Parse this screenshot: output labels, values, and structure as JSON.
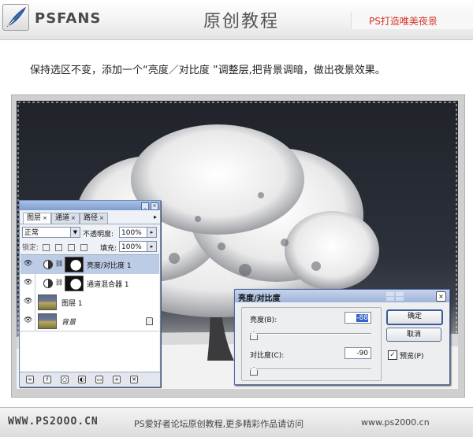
{
  "banner": {
    "logo": "PSFANS",
    "title": "原创教程",
    "right_text": "PS打造唯美夜景"
  },
  "instruction": "保持选区不变，添加一个“亮度／对比度 ”调整层,把背景调暗，做出夜景效果。",
  "layers_panel": {
    "tabs": [
      {
        "label": "图层",
        "active": true
      },
      {
        "label": "通道",
        "active": false
      },
      {
        "label": "路径",
        "active": false
      }
    ],
    "blend_mode": "正常",
    "opacity_label": "不透明度:",
    "opacity_value": "100%",
    "lock_label": "锁定:",
    "fill_label": "填充:",
    "fill_value": "100%",
    "layers": [
      {
        "name": "亮度/对比度 1",
        "selected": true,
        "type": "adjustment"
      },
      {
        "name": "通道混合器 1",
        "selected": false,
        "type": "adjustment"
      },
      {
        "name": "图层 1",
        "selected": false,
        "type": "image"
      },
      {
        "name": "背景",
        "selected": false,
        "type": "background"
      }
    ]
  },
  "dialog": {
    "title": "亮度/对比度",
    "brightness_label": "亮度(B):",
    "brightness_value": "-88",
    "contrast_label": "对比度(C):",
    "contrast_value": "-90",
    "ok_label": "确定",
    "cancel_label": "取消",
    "preview_label": "预览(P)",
    "preview_checked": true
  },
  "footer": {
    "left": "WWW.PS2OOO.CN",
    "middle": "PS爱好者论坛原创教程,更多精彩作品请访问",
    "right": "www.ps2000.cn"
  }
}
